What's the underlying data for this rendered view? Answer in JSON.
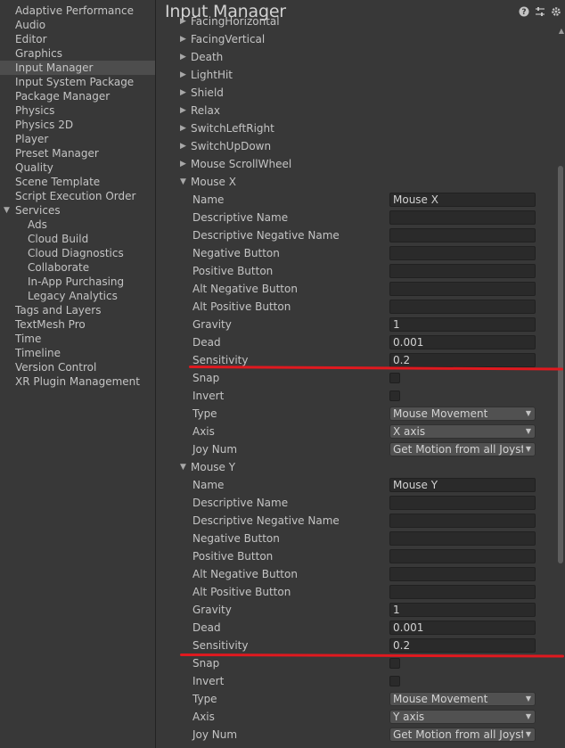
{
  "sidebar": {
    "items": [
      {
        "label": "Adaptive Performance",
        "level": 0
      },
      {
        "label": "Audio",
        "level": 0
      },
      {
        "label": "Editor",
        "level": 0
      },
      {
        "label": "Graphics",
        "level": 0
      },
      {
        "label": "Input Manager",
        "level": 0,
        "selected": true
      },
      {
        "label": "Input System Package",
        "level": 0
      },
      {
        "label": "Package Manager",
        "level": 0
      },
      {
        "label": "Physics",
        "level": 0
      },
      {
        "label": "Physics 2D",
        "level": 0
      },
      {
        "label": "Player",
        "level": 0
      },
      {
        "label": "Preset Manager",
        "level": 0
      },
      {
        "label": "Quality",
        "level": 0
      },
      {
        "label": "Scene Template",
        "level": 0
      },
      {
        "label": "Script Execution Order",
        "level": 0
      },
      {
        "label": "Services",
        "level": 0,
        "foldout": "expanded"
      },
      {
        "label": "Ads",
        "level": 1
      },
      {
        "label": "Cloud Build",
        "level": 1
      },
      {
        "label": "Cloud Diagnostics",
        "level": 1
      },
      {
        "label": "Collaborate",
        "level": 1
      },
      {
        "label": "In-App Purchasing",
        "level": 1
      },
      {
        "label": "Legacy Analytics",
        "level": 1
      },
      {
        "label": "Tags and Layers",
        "level": 0
      },
      {
        "label": "TextMesh Pro",
        "level": 0
      },
      {
        "label": "Time",
        "level": 0
      },
      {
        "label": "Timeline",
        "level": 0
      },
      {
        "label": "Version Control",
        "level": 0
      },
      {
        "label": "XR Plugin Management",
        "level": 0
      }
    ]
  },
  "header": {
    "title": "Input Manager",
    "icons": [
      "help-icon",
      "preset-sliders-icon",
      "gear-icon"
    ]
  },
  "colors": {
    "background": "#383838",
    "field": "#2a2a2a",
    "dropdown": "#515151",
    "annotation_red": "#e0191f",
    "text": "#c4c4c4"
  },
  "collapsed_axes": [
    "FacingHorizontal",
    "FacingVertical",
    "Death",
    "LightHit",
    "Shield",
    "Relax",
    "SwitchLeftRight",
    "SwitchUpDown",
    "Mouse ScrollWheel"
  ],
  "mouse_x": {
    "header": "Mouse X",
    "labels": {
      "name": "Name",
      "descriptive_name": "Descriptive Name",
      "descriptive_negative_name": "Descriptive Negative Name",
      "negative_button": "Negative Button",
      "positive_button": "Positive Button",
      "alt_negative_button": "Alt Negative Button",
      "alt_positive_button": "Alt Positive Button",
      "gravity": "Gravity",
      "dead": "Dead",
      "sensitivity": "Sensitivity",
      "snap": "Snap",
      "invert": "Invert",
      "type": "Type",
      "axis": "Axis",
      "joy_num": "Joy Num"
    },
    "values": {
      "name": "Mouse X",
      "descriptive_name": "",
      "descriptive_negative_name": "",
      "negative_button": "",
      "positive_button": "",
      "alt_negative_button": "",
      "alt_positive_button": "",
      "gravity": "1",
      "dead": "0.001",
      "sensitivity": "0.2",
      "snap": false,
      "invert": false,
      "type": "Mouse Movement",
      "axis": "X axis",
      "joy_num": "Get Motion from all Joystic"
    }
  },
  "mouse_y": {
    "header": "Mouse Y",
    "labels": {
      "name": "Name",
      "descriptive_name": "Descriptive Name",
      "descriptive_negative_name": "Descriptive Negative Name",
      "negative_button": "Negative Button",
      "positive_button": "Positive Button",
      "alt_negative_button": "Alt Negative Button",
      "alt_positive_button": "Alt Positive Button",
      "gravity": "Gravity",
      "dead": "Dead",
      "sensitivity": "Sensitivity",
      "snap": "Snap",
      "invert": "Invert",
      "type": "Type",
      "axis": "Axis",
      "joy_num": "Joy Num"
    },
    "values": {
      "name": "Mouse Y",
      "descriptive_name": "",
      "descriptive_negative_name": "",
      "negative_button": "",
      "positive_button": "",
      "alt_negative_button": "",
      "alt_positive_button": "",
      "gravity": "1",
      "dead": "0.001",
      "sensitivity": "0.2",
      "snap": false,
      "invert": false,
      "type": "Mouse Movement",
      "axis": "Y axis",
      "joy_num": "Get Motion from all Joystic"
    }
  }
}
